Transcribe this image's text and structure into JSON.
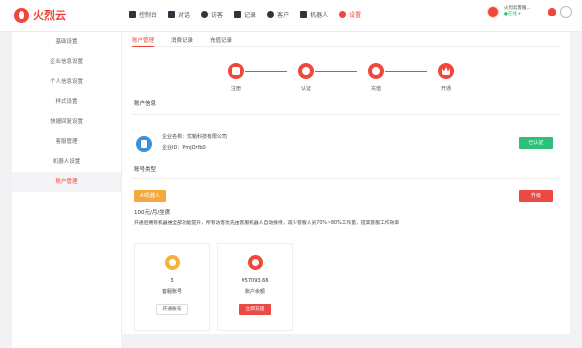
{
  "brand": {
    "name": "火烈云"
  },
  "nav": [
    {
      "label": "控制台",
      "icon": "home-icon"
    },
    {
      "label": "对话",
      "icon": "chat-icon"
    },
    {
      "label": "访客",
      "icon": "visitors-icon"
    },
    {
      "label": "记录",
      "icon": "records-icon"
    },
    {
      "label": "客户",
      "icon": "customer-icon"
    },
    {
      "label": "机器人",
      "icon": "robot-icon"
    },
    {
      "label": "设置",
      "icon": "settings-icon"
    }
  ],
  "user": {
    "name": "火烈云客服...",
    "status": "●在线 ▾"
  },
  "sidebar": {
    "items": [
      {
        "label": "基础设置"
      },
      {
        "label": "企业信息设置"
      },
      {
        "label": "个人信息设置"
      },
      {
        "label": "样式设置"
      },
      {
        "label": "快捷回复设置"
      },
      {
        "label": "客服管理"
      },
      {
        "label": "机器人设置"
      },
      {
        "label": "账户管理"
      }
    ]
  },
  "tabs": [
    {
      "label": "账户管理"
    },
    {
      "label": "消费记录"
    },
    {
      "label": "充值记录"
    }
  ],
  "steps": [
    {
      "label": "注册",
      "icon": "register-icon"
    },
    {
      "label": "认证",
      "icon": "verify-icon"
    },
    {
      "label": "充值",
      "icon": "recharge-icon"
    },
    {
      "label": "开通",
      "icon": "crown-icon"
    }
  ],
  "account_info": {
    "title": "账户信息",
    "company_name": "企业名称：优魁科技有限公司",
    "company_id": "企业ID：PmjOrfb0",
    "cert_badge": "已认证"
  },
  "account_type": {
    "title": "账号类型",
    "tag": "AI机器人",
    "upgrade": "升级",
    "price": "100元/月/坐席",
    "desc": "开通后拥有机器维全部功能提升，所有访客优先由客服机器人自动接待，减少客服人员70%~80%工作量，提高客服工作效率"
  },
  "cards": [
    {
      "value": "3",
      "label": "客服账号",
      "button": "开通账号"
    },
    {
      "value": "¥57093.66",
      "label": "账户余额",
      "button": "立即充值"
    }
  ],
  "colors": {
    "accent": "#f0463c",
    "success": "#2cc07a",
    "warning": "#f5a93a"
  }
}
